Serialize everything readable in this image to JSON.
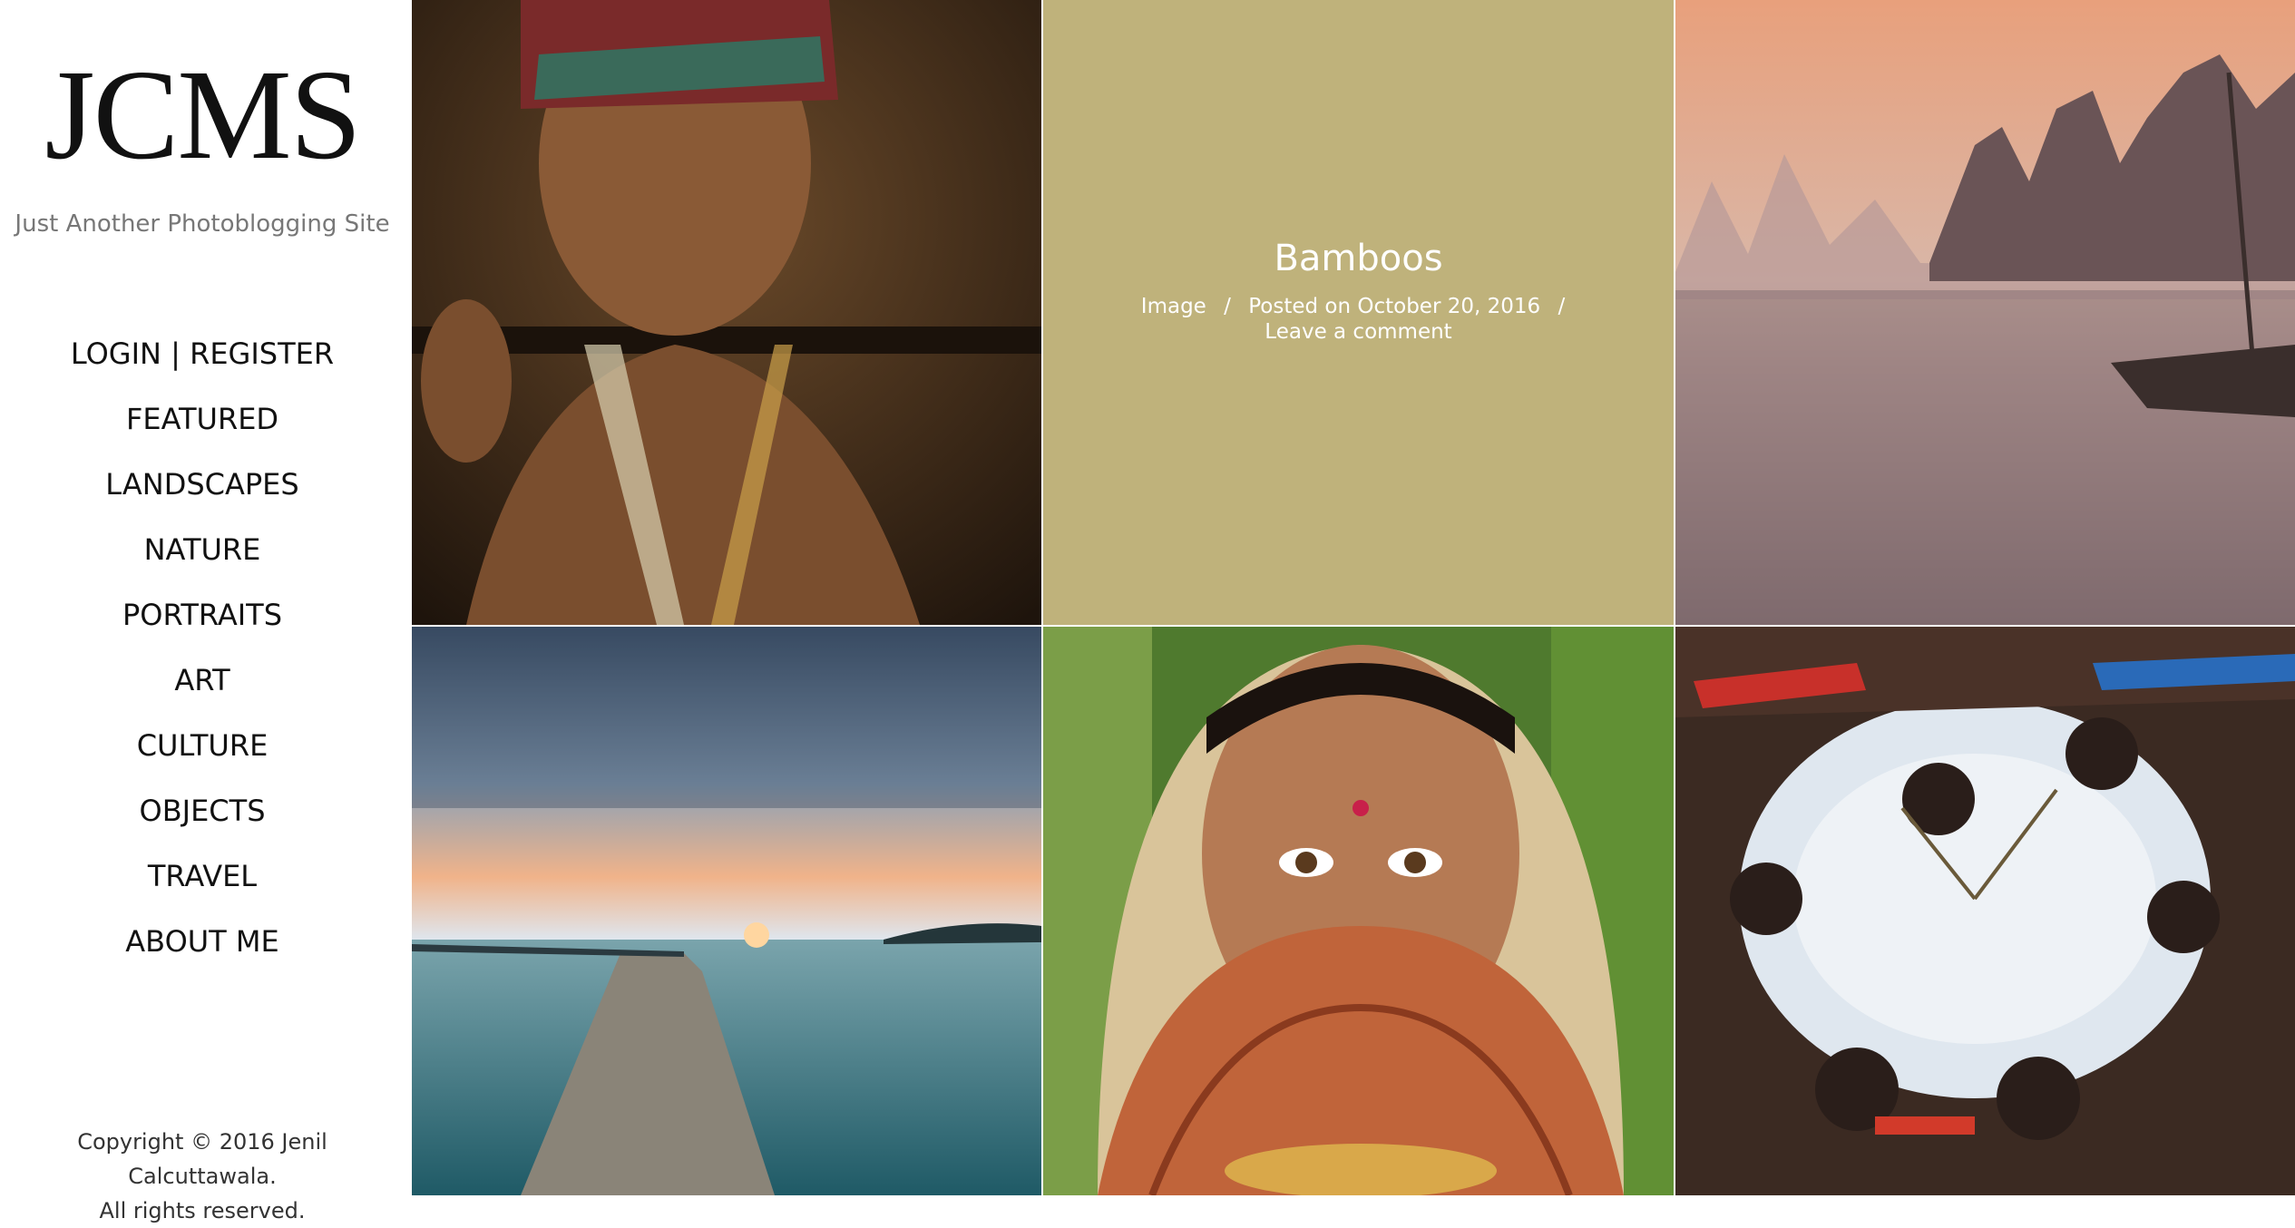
{
  "site": {
    "title": "JCMS",
    "tagline": "Just Another Photoblogging Site"
  },
  "nav": {
    "items": [
      {
        "label": "LOGIN | REGISTER"
      },
      {
        "label": "FEATURED"
      },
      {
        "label": "LANDSCAPES"
      },
      {
        "label": "NATURE"
      },
      {
        "label": "PORTRAITS"
      },
      {
        "label": "ART"
      },
      {
        "label": "CULTURE"
      },
      {
        "label": "OBJECTS"
      },
      {
        "label": "TRAVEL"
      },
      {
        "label": "ABOUT ME"
      }
    ]
  },
  "footer": {
    "copyright_line1": "Copyright © 2016 Jenil Calcuttawala.",
    "copyright_line2": "All rights reserved."
  },
  "featured_post": {
    "title": "Bamboos",
    "format": "Image",
    "posted": "Posted on October 20, 2016",
    "comment_link": "Leave a comment",
    "separator": "/",
    "background": "#bfb27b"
  },
  "photos": [
    {
      "icon": "portrait-photo",
      "subject": "elder-man"
    },
    {
      "icon": "landscape-photo",
      "subject": "river-karst"
    },
    {
      "icon": "landscape-photo",
      "subject": "pier-sunset"
    },
    {
      "icon": "portrait-photo",
      "subject": "bride-henna"
    },
    {
      "icon": "culture-photo",
      "subject": "tribal-circle"
    }
  ]
}
